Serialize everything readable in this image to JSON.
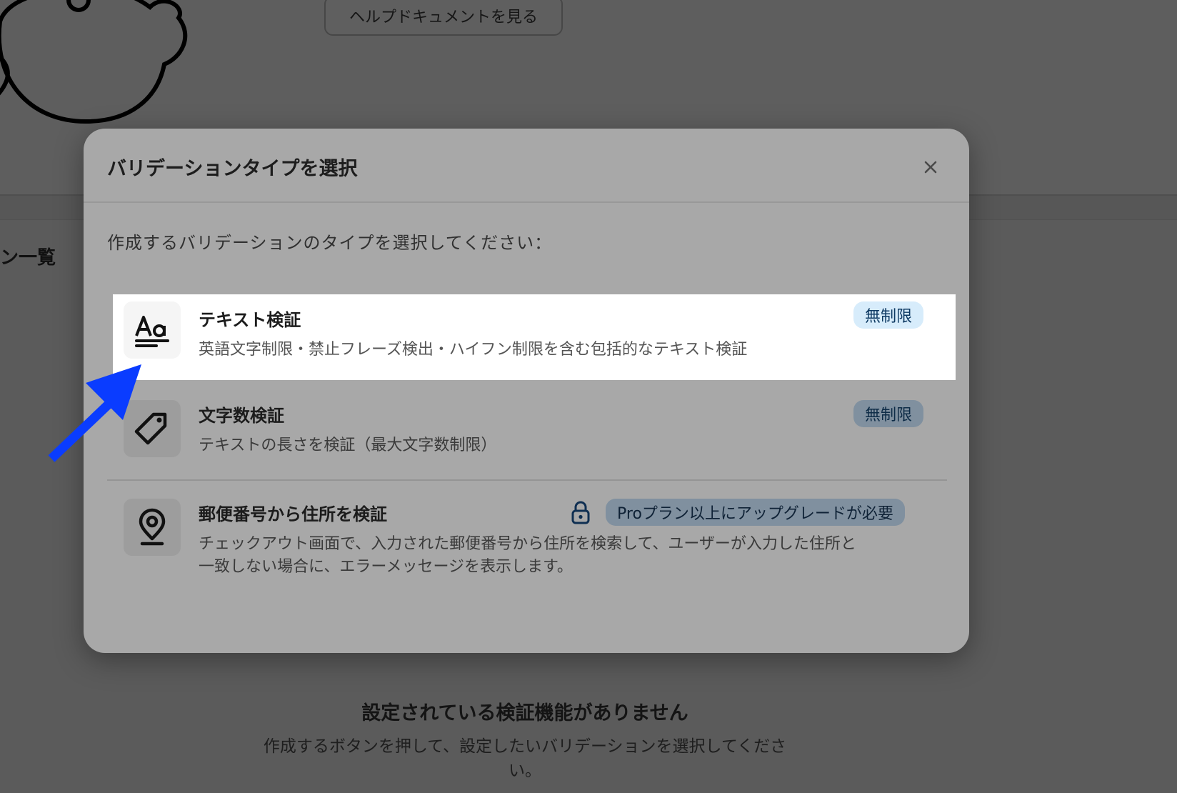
{
  "background": {
    "help_button_label": "ヘルプドキュメントを見る",
    "section_title": "ン一覧",
    "empty_state": {
      "title": "設定されている検証機能がありません",
      "description": "作成するボタンを押して、設定したいバリデーションを選択してください。"
    }
  },
  "modal": {
    "title": "バリデーションタイプを選択",
    "close_label": "×",
    "intro": "作成するバリデーションのタイプを選択してください：",
    "options": [
      {
        "title": "テキスト検証",
        "description": "英語文字制限・禁止フレーズ検出・ハイフン制限を含む包括的なテキスト検証",
        "badge": "無制限",
        "icon": "text-format-icon",
        "highlighted": true
      },
      {
        "title": "文字数検証",
        "description": "テキストの長さを検証（最大文字数制限）",
        "badge": "無制限",
        "icon": "tag-icon"
      },
      {
        "title": "郵便番号から住所を検証",
        "description_line1": "チェックアウト画面で、入力された郵便番号から住所を検索して、ユーザーが入力した住所と",
        "description_line2": "一致しない場合に、エラーメッセージを表示します。",
        "badge": "Proプラン以上にアップグレードが必要",
        "icon": "map-pin-icon",
        "locked": true
      }
    ]
  },
  "colors": {
    "overlay": "#5b5b5b",
    "modal_bg": "#a8a8a8",
    "badge_unlimited_bg": "#d7ecfb",
    "arrow": "#0a3cff"
  }
}
